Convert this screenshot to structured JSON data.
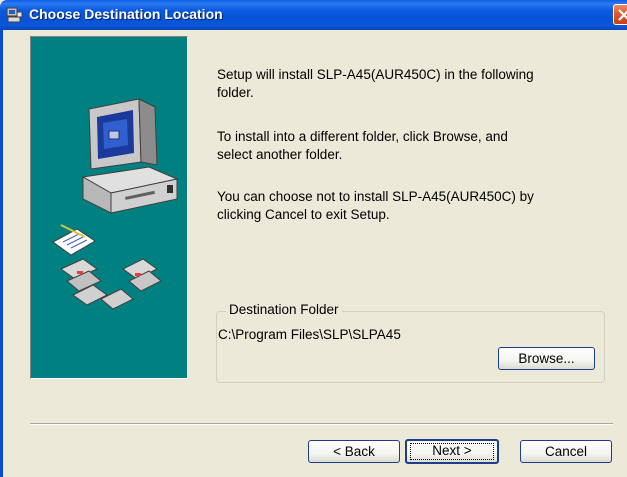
{
  "window": {
    "title": "Choose Destination Location",
    "icon": "setup-icon"
  },
  "message": {
    "line1a": "Setup will install SLP-A45(AUR450C) in the following",
    "line1b": "folder.",
    "line2a": "To install into a different folder, click Browse, and",
    "line2b": "select another folder.",
    "line3a": "You can choose not to install SLP-A45(AUR450C) by",
    "line3b": "clicking Cancel to exit Setup."
  },
  "destination": {
    "group_label": "Destination Folder",
    "path": "C:\\Program Files\\SLP\\SLPA45",
    "browse_label": "Browse..."
  },
  "buttons": {
    "back_label": "< Back",
    "next_label": "Next >",
    "cancel_label": "Cancel"
  },
  "colors": {
    "title_bar": "#0a5ae0",
    "art_background": "#008080",
    "dialog_background": "#ece9d8",
    "close_button": "#e0582c"
  }
}
